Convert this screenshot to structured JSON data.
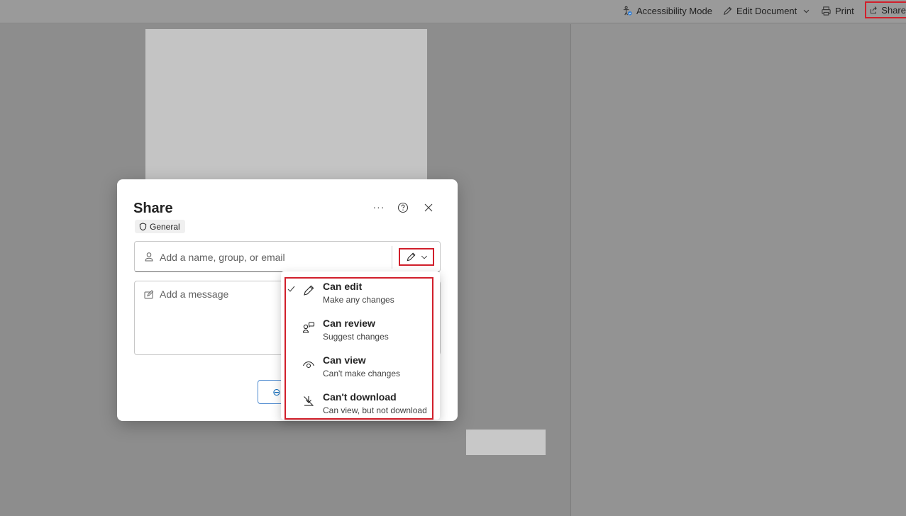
{
  "toolbar": {
    "accessibility_label": "Accessibility Mode",
    "edit_label": "Edit Document",
    "print_label": "Print",
    "share_label": "Share"
  },
  "dialog": {
    "title": "Share",
    "more_label": "···",
    "sensitivity_label": "General",
    "recipient_placeholder": "Add a name, group, or email",
    "message_placeholder": "Add a message"
  },
  "permissions_menu": {
    "items": [
      {
        "title": "Can edit",
        "subtitle": "Make any changes",
        "icon": "pencil-icon",
        "selected": true
      },
      {
        "title": "Can review",
        "subtitle": "Suggest changes",
        "icon": "review-icon",
        "selected": false
      },
      {
        "title": "Can view",
        "subtitle": "Can't make changes",
        "icon": "eye-icon",
        "selected": false
      },
      {
        "title": "Can't download",
        "subtitle": "Can view, but not download",
        "icon": "no-download-icon",
        "selected": false
      }
    ]
  },
  "colors": {
    "highlight": "#d11f2b",
    "accent": "#0f6cbd"
  }
}
